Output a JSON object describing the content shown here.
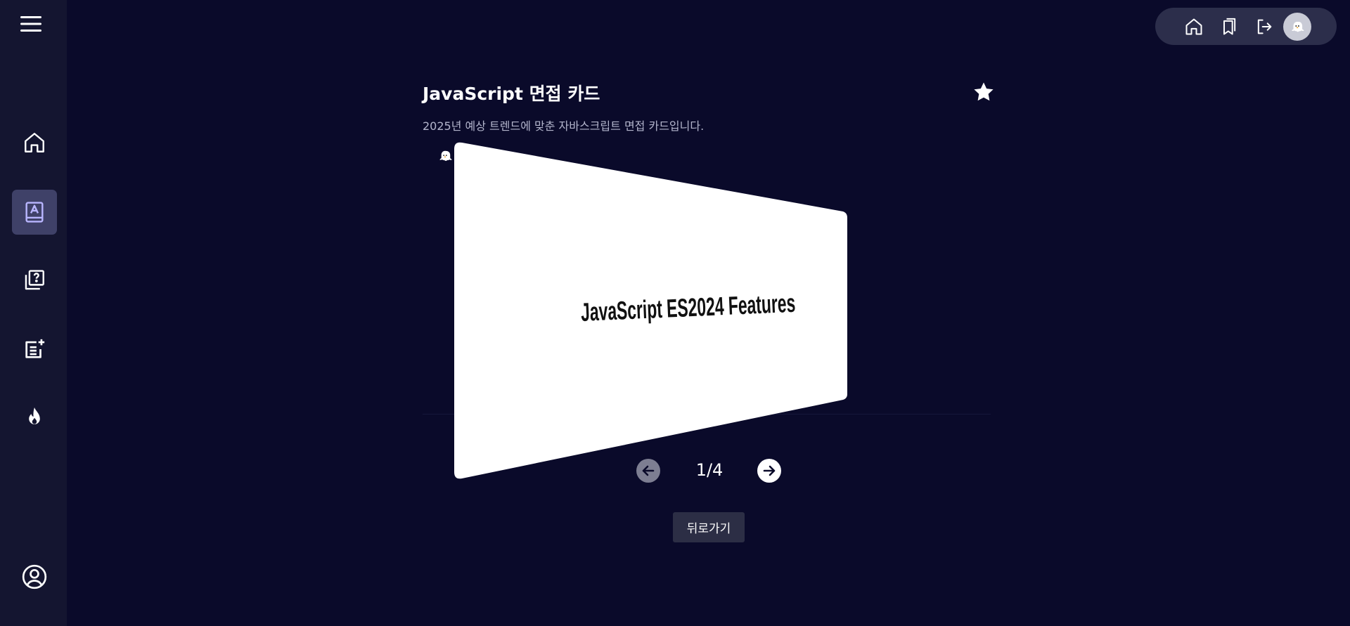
{
  "sidebar": {
    "items": [
      {
        "name": "home-icon"
      },
      {
        "name": "study-book-icon",
        "active": true
      },
      {
        "name": "quiz-library-icon"
      },
      {
        "name": "create-note-icon"
      },
      {
        "name": "fire-icon"
      }
    ],
    "profile_icon": "user-circle-icon",
    "menu_icon": "hamburger-menu-icon"
  },
  "topbar": {
    "icons": [
      "home-icon",
      "bookmarks-icon",
      "logout-icon",
      "avatar-ghost"
    ]
  },
  "deck": {
    "title": "JavaScript 면접 카드",
    "description": "2025년 예상 트렌드에 맞춘 자바스크립트 면접 카드입니다.",
    "favorite_icon": "star-icon"
  },
  "card": {
    "front_text": "JavaScript ES2024 Features"
  },
  "pagination": {
    "current": 1,
    "total": 4,
    "label": "1/4"
  },
  "actions": {
    "back_label": "뒤로가기"
  },
  "colors": {
    "background": "#0a0a2a",
    "sidebar": "#141530",
    "active_item": "#3f4168",
    "topbar": "#2c2e4b",
    "accent": "#b9b6ff"
  }
}
